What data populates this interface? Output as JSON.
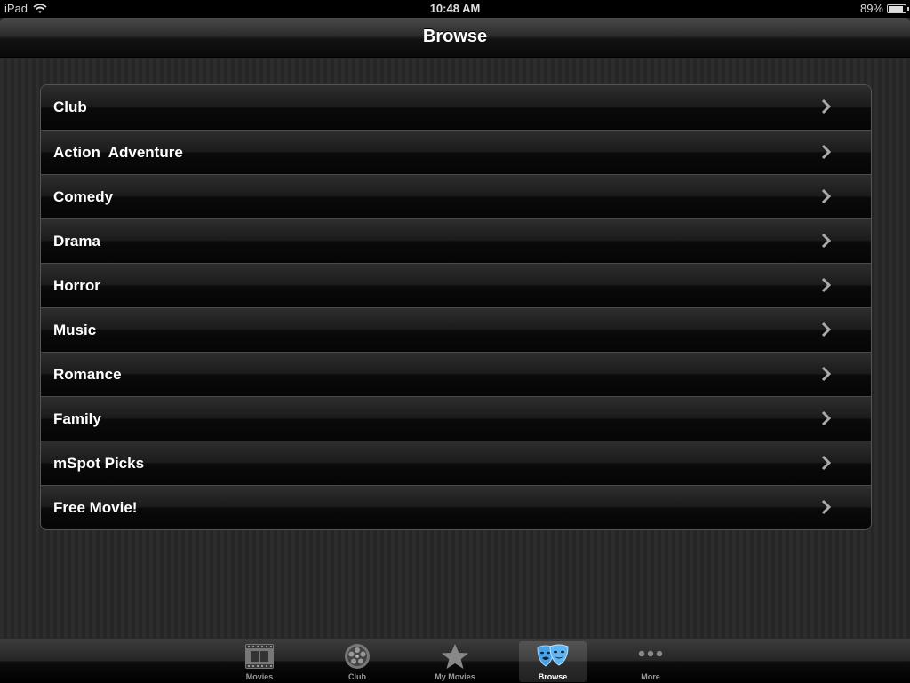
{
  "status_bar": {
    "device": "iPad",
    "time": "10:48 AM",
    "battery_percent": "89%",
    "battery_level": 0.89
  },
  "nav": {
    "title": "Browse"
  },
  "list": {
    "items": [
      {
        "label": "Club"
      },
      {
        "label": "Action  Adventure"
      },
      {
        "label": "Comedy"
      },
      {
        "label": "Drama"
      },
      {
        "label": "Horror"
      },
      {
        "label": "Music"
      },
      {
        "label": "Romance"
      },
      {
        "label": "Family"
      },
      {
        "label": "mSpot Picks"
      },
      {
        "label": "Free Movie!"
      }
    ]
  },
  "tabbar": {
    "selected": "Browse",
    "tabs": [
      {
        "label": "Movies",
        "icon": "film-icon"
      },
      {
        "label": "Club",
        "icon": "film-reel-icon"
      },
      {
        "label": "My Movies",
        "icon": "star-icon"
      },
      {
        "label": "Browse",
        "icon": "theater-masks-icon"
      },
      {
        "label": "More",
        "icon": "more-dots-icon"
      }
    ]
  },
  "colors": {
    "accent_blue": "#4aa3e8",
    "text": "#ffffff",
    "tab_inactive": "#999999"
  }
}
